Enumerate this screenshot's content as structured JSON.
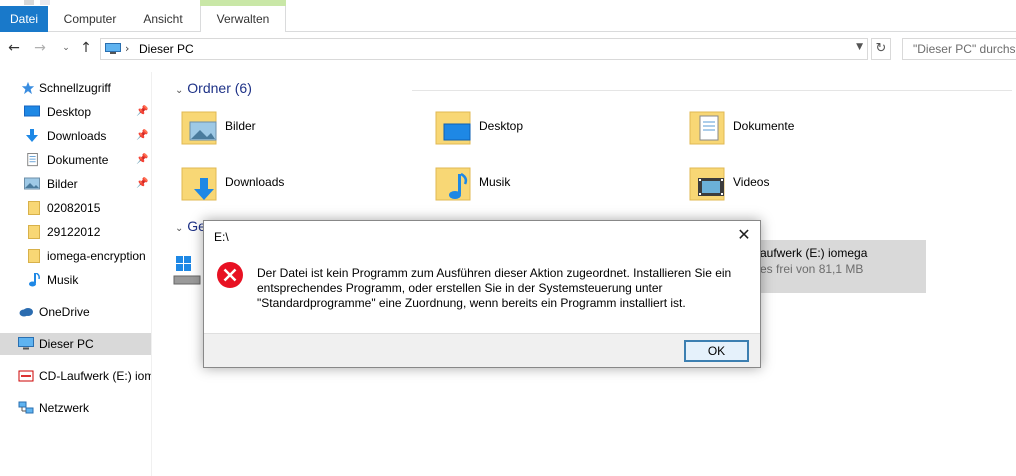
{
  "ribbon": {
    "tabs": [
      {
        "label": "Datei"
      },
      {
        "label": "Computer"
      },
      {
        "label": "Ansicht"
      },
      {
        "label": "Verwalten"
      }
    ]
  },
  "address": {
    "breadcrumb": "Dieser PC",
    "search_placeholder": "\"Dieser PC\" durchsuchen"
  },
  "navpane": {
    "items": [
      {
        "label": "Schnellzugriff",
        "icon": "star-icon"
      },
      {
        "label": "Desktop",
        "icon": "desktop-icon",
        "pinned": true
      },
      {
        "label": "Downloads",
        "icon": "download-arrow-icon",
        "pinned": true
      },
      {
        "label": "Dokumente",
        "icon": "document-icon",
        "pinned": true
      },
      {
        "label": "Bilder",
        "icon": "pictures-icon",
        "pinned": true
      },
      {
        "label": "02082015",
        "icon": "folder-icon"
      },
      {
        "label": "29122012",
        "icon": "folder-icon"
      },
      {
        "label": "iomega-encryption",
        "icon": "folder-icon"
      },
      {
        "label": "Musik",
        "icon": "music-note-icon"
      },
      {
        "label": "OneDrive",
        "icon": "cloud-icon"
      },
      {
        "label": "Dieser PC",
        "icon": "computer-icon",
        "selected": true
      },
      {
        "label": "CD-Laufwerk (E:) iomega",
        "icon": "cd-drive-icon"
      },
      {
        "label": "Netzwerk",
        "icon": "network-icon"
      }
    ]
  },
  "content": {
    "folders_header": "Ordner (6)",
    "devices_header": "Gerä",
    "folders": [
      {
        "label": "Bilder",
        "icon": "pictures-folder-icon"
      },
      {
        "label": "Desktop",
        "icon": "desktop-folder-icon"
      },
      {
        "label": "Dokumente",
        "icon": "documents-folder-icon"
      },
      {
        "label": "Downloads",
        "icon": "downloads-folder-icon"
      },
      {
        "label": "Musik",
        "icon": "music-folder-icon"
      },
      {
        "label": "Videos",
        "icon": "videos-folder-icon"
      }
    ],
    "drive": {
      "name": "aufwerk (E:) iomega",
      "free": "es frei von 81,1 MB"
    }
  },
  "dialog": {
    "title": "E:\\",
    "message": "Der Datei ist kein Programm zum Ausführen dieser Aktion zugeordnet. Installieren Sie ein entsprechendes Programm, oder erstellen Sie in der Systemsteuerung unter \"Standardprogramme\" eine Zuordnung, wenn bereits ein Programm installiert ist.",
    "ok_label": "OK",
    "icon": "error-x-icon"
  },
  "colors": {
    "accent": "#1979ca",
    "manage_tab": "#c9e7a7",
    "error_red": "#e81123",
    "folder_yellow": "#f8d775",
    "selected_bg": "#d9d9d9"
  }
}
